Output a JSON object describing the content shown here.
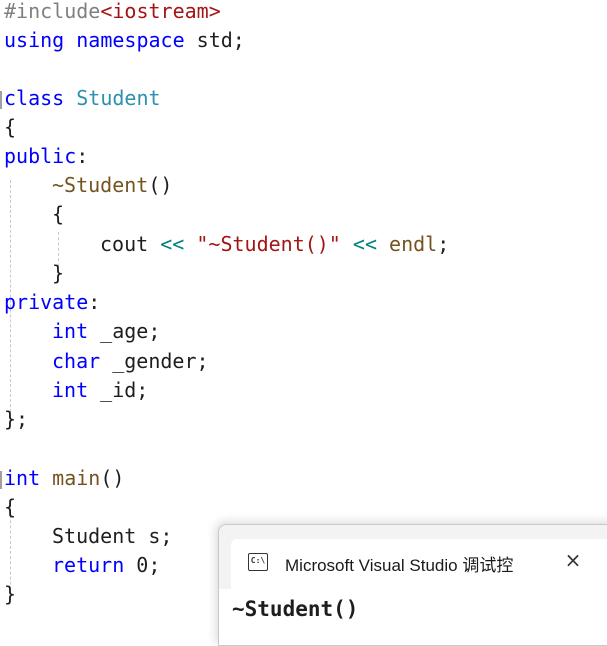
{
  "editor": {
    "line1": {
      "directive": "#include",
      "header": "<iostream>"
    },
    "line2": {
      "kw1": "using",
      "kw2": "namespace",
      "rest": " std;"
    },
    "line4": {
      "kw": "class",
      "name": "Student"
    },
    "line5": {
      "text": "{"
    },
    "line6": {
      "kw": "public",
      "rest": ":"
    },
    "line7": {
      "fn": "~Student",
      "rest": "()"
    },
    "line8": {
      "text": "{"
    },
    "line9": {
      "obj": "cout",
      "op1": "<<",
      "str": "\"~Student()\"",
      "op2": "<<",
      "fn": "endl",
      "rest": ";"
    },
    "line10": {
      "text": "}"
    },
    "line11": {
      "kw": "private",
      "rest": ":"
    },
    "line12": {
      "kw": "int",
      "rest": " _age;"
    },
    "line13": {
      "kw": "char",
      "rest": " _gender;"
    },
    "line14": {
      "kw": "int",
      "rest": " _id;"
    },
    "line15": {
      "text": "};"
    },
    "line17": {
      "kw": "int",
      "fn": "main",
      "rest": "()"
    },
    "line18": {
      "text": "{"
    },
    "line19": {
      "type": "Student",
      "rest": " s;"
    },
    "line20": {
      "kw": "return",
      "rest": " 0;"
    },
    "line21": {
      "text": "}"
    }
  },
  "console": {
    "icon_text": "C:\\",
    "title": "Microsoft Visual Studio 调试控",
    "close_label": "×",
    "output": "~Student()"
  },
  "colors": {
    "keyword": "#0000ff",
    "preprocessor": "#808080",
    "string": "#a31515",
    "type": "#2b91af",
    "function": "#74531f",
    "operator": "#008080"
  }
}
